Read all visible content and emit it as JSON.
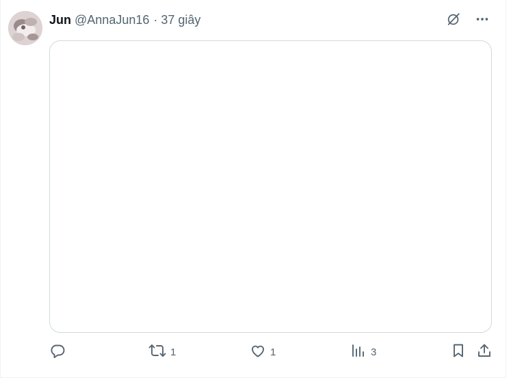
{
  "tweet": {
    "author_name": "Jun",
    "author_handle": "@AnnaJun16",
    "separator": "·",
    "timestamp": "37 giây"
  },
  "icons": {
    "grok": "grok-icon",
    "more": "more-icon",
    "reply": "reply-icon",
    "retweet": "retweet-icon",
    "like": "heart-icon",
    "views": "views-icon",
    "bookmark": "bookmark-icon",
    "share": "share-icon"
  },
  "actions": {
    "reply_count": "",
    "retweet_count": "1",
    "like_count": "1",
    "views_count": "3"
  },
  "colors": {
    "text": "#0f1419",
    "secondary": "#536471",
    "border": "#cfd9de"
  }
}
